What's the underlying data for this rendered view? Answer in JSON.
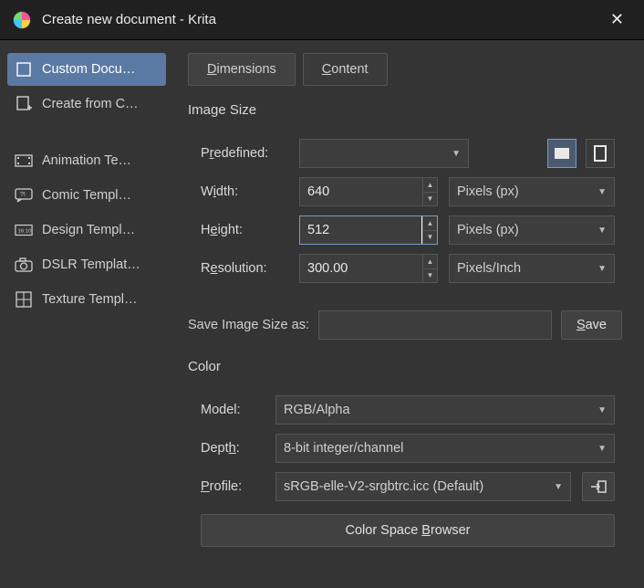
{
  "window": {
    "title": "Create new document - Krita"
  },
  "sidebar": {
    "items": [
      {
        "label": "Custom Docu…"
      },
      {
        "label": "Create from C…"
      },
      {
        "label": "Animation Te…"
      },
      {
        "label": "Comic Templ…"
      },
      {
        "label": "Design Templ…"
      },
      {
        "label": "DSLR Templat…"
      },
      {
        "label": "Texture Templ…"
      }
    ]
  },
  "tabs": {
    "dimensions": "Dimensions",
    "content": "Content"
  },
  "sections": {
    "image_size": "Image Size",
    "color": "Color"
  },
  "fields": {
    "predefined_label": "Predefined:",
    "predefined_value": "",
    "width_label": "Width:",
    "width_value": "640",
    "width_unit": "Pixels (px)",
    "height_label": "Height:",
    "height_value": "512",
    "height_unit": "Pixels (px)",
    "resolution_label": "Resolution:",
    "resolution_value": "300.00",
    "resolution_unit": "Pixels/Inch",
    "save_as_label": "Save Image Size as:",
    "save_as_value": "",
    "save_btn": "Save",
    "model_label": "Model:",
    "model_value": "RGB/Alpha",
    "depth_label": "Depth:",
    "depth_value": "8-bit integer/channel",
    "profile_label": "Profile:",
    "profile_value": "sRGB-elle-V2-srgbtrc.icc (Default)",
    "color_browser_btn": "Color Space Browser"
  }
}
